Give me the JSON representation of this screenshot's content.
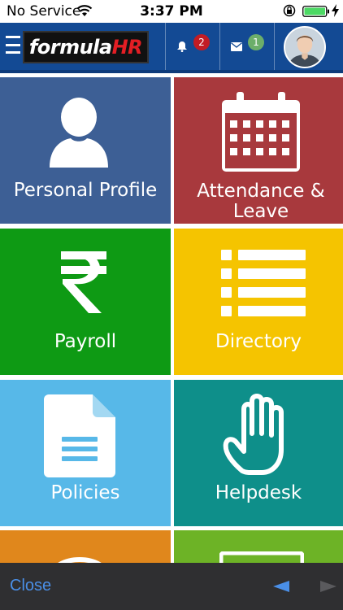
{
  "status_bar": {
    "carrier": "No Service",
    "time": "3:37 PM"
  },
  "header": {
    "logo_text": "formula",
    "logo_accent": "HR",
    "notifications_count": "2",
    "messages_count": "1"
  },
  "tiles": [
    {
      "label": "Personal Profile",
      "icon": "person-icon",
      "color": "#3d5f95"
    },
    {
      "label": "Attendance & Leave",
      "icon": "calendar-icon",
      "color": "#a8393d"
    },
    {
      "label": "Payroll",
      "icon": "rupee-icon",
      "color": "#0e9a14"
    },
    {
      "label": "Directory",
      "icon": "list-icon",
      "color": "#f5c400"
    },
    {
      "label": "Policies",
      "icon": "document-icon",
      "color": "#57b8e8"
    },
    {
      "label": "Helpdesk",
      "icon": "hand-icon",
      "color": "#0e8f8a"
    }
  ],
  "partial_tiles": [
    {
      "icon": "chat-icon",
      "color": "#e0871c"
    },
    {
      "icon": "monitor-icon",
      "color": "#6db326"
    }
  ],
  "toolbar": {
    "close_label": "Close"
  },
  "colors": {
    "header_bg": "#134a94",
    "toolbar_bg": "#2f2f31",
    "link_blue": "#4a8fe7"
  }
}
